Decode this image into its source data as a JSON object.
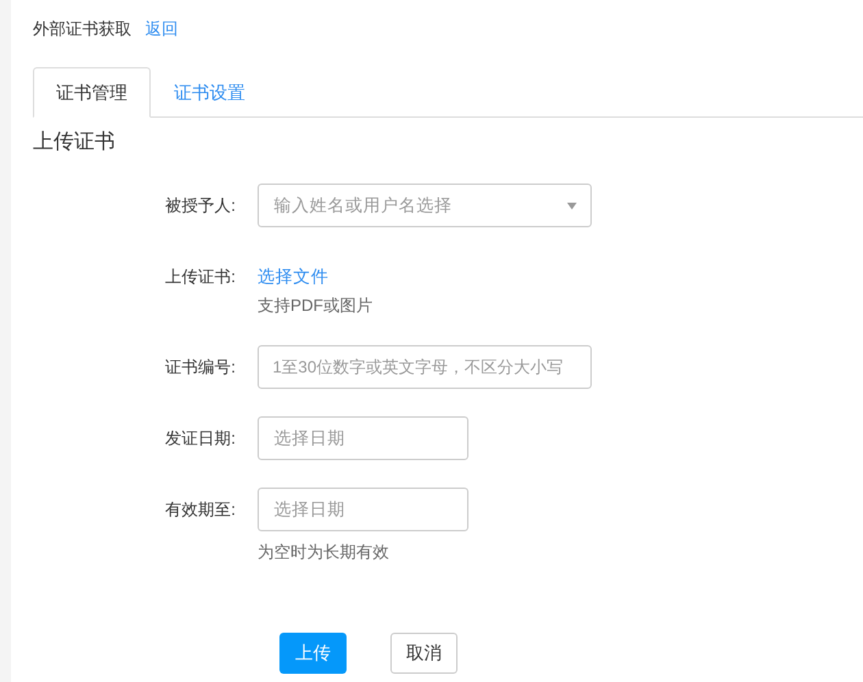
{
  "header": {
    "title": "外部证书获取",
    "back_link": "返回"
  },
  "tabs": [
    {
      "label": "证书管理",
      "selected": true
    },
    {
      "label": "证书设置",
      "selected": false
    }
  ],
  "section_title": "上传证书",
  "form": [
    {
      "kind": "select",
      "label": "被授予人:",
      "placeholder": "输入姓名或用户名选择"
    },
    {
      "kind": "file",
      "label": "上传证书:",
      "link": "选择文件",
      "hint": "支持PDF或图片"
    },
    {
      "kind": "text",
      "label": "证书编号:",
      "placeholder": "1至30位数字或英文字母，不区分大小写"
    },
    {
      "kind": "date",
      "label": "发证日期:",
      "placeholder": "选择日期"
    },
    {
      "kind": "date",
      "label": "有效期至:",
      "placeholder": "选择日期",
      "hint": "为空时为长期有效"
    }
  ],
  "buttons": [
    {
      "kind": "primary",
      "label": "上传"
    },
    {
      "kind": "default",
      "label": "取消"
    }
  ]
}
